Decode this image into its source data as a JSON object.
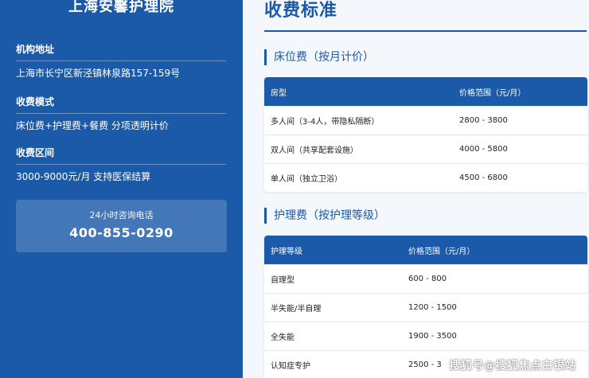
{
  "sidebar": {
    "org_name": "上海安馨护理院",
    "address_label": "机构地址",
    "address_value": "上海市长宁区新泾镇林泉路157-159号",
    "mode_label": "收费模式",
    "mode_value": "床位费+护理费+餐费 分项透明计价",
    "range_label": "收费区间",
    "range_value": "3000-9000元/月 支持医保结算",
    "hotline_label": "24小时咨询电话",
    "hotline_phone": "400-855-0290"
  },
  "main": {
    "title": "收费标准",
    "bed_section": {
      "title": "床位费（按月计价）",
      "headers": [
        "房型",
        "价格范围（元/月）"
      ],
      "rows": [
        [
          "多人间（3-4人，带隐私隔断）",
          "2800 - 3800"
        ],
        [
          "双人间（共享配套设施）",
          "4000 - 5800"
        ],
        [
          "单人间（独立卫浴）",
          "4500 - 6800"
        ]
      ]
    },
    "care_section": {
      "title": "护理费（按护理等级）",
      "headers": [
        "护理等级",
        "价格范围（元/月）"
      ],
      "rows": [
        [
          "自理型",
          "600 - 800"
        ],
        [
          "半失能/半自理",
          "1200 - 1500"
        ],
        [
          "全失能",
          "1900 - 3500"
        ],
        [
          "认知症专护",
          "2500 - 3"
        ]
      ]
    }
  },
  "watermark": "搜狐号@搜狐焦点白银站"
}
